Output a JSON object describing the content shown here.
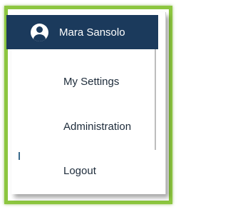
{
  "user": {
    "name": "Mara Sansolo",
    "icon": "user-circle-icon"
  },
  "menu": {
    "items": [
      {
        "label": "My Settings"
      },
      {
        "label": "Administration"
      },
      {
        "label": "Logout"
      }
    ]
  },
  "colors": {
    "header_bg": "#1b3a5c",
    "frame_border": "#8cc63f",
    "item_text": "#1d2b3a"
  }
}
